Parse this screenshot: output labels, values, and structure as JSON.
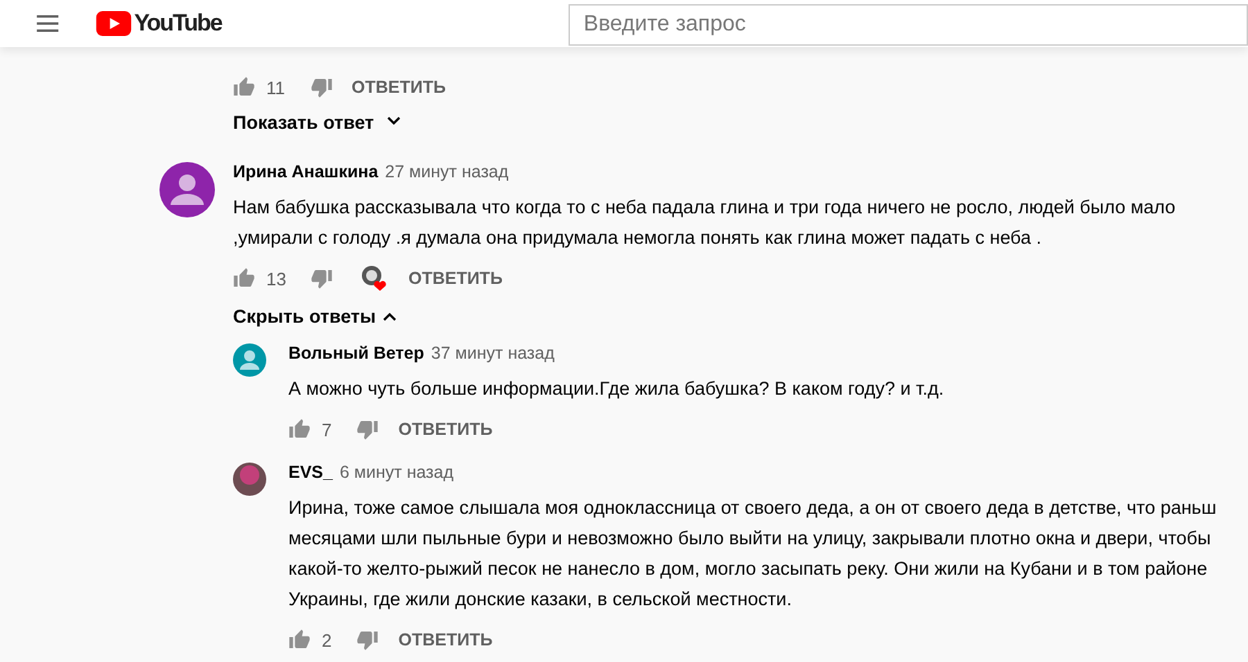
{
  "header": {
    "logo_text": "YouTube",
    "search": {
      "placeholder": "Введите запрос"
    }
  },
  "top_comment": {
    "likes": "11",
    "reply_label": "ОТВЕТИТЬ",
    "toggle_label": "Показать ответ",
    "expanded": false
  },
  "comment": {
    "author": "Ирина Анашкина",
    "time": "27 минут назад",
    "text": "Нам бабушка рассказывала что когда то с неба падала глина и три года ничего не росло, людей было мало\n,умирали с голоду .я думала она придумала немогла понять как глина может падать с неба .",
    "likes": "13",
    "hearted": true,
    "reply_label": "ОТВЕТИТЬ",
    "toggle_label": "Скрыть ответы",
    "expanded": true,
    "replies": [
      {
        "author": "Вольный Ветер",
        "time": "37 минут назад",
        "kind": "default_avatar",
        "text": "А можно чуть больше информации.Где жила бабушка? В каком году? и т.д.",
        "likes": "7",
        "reply_label": "ОТВЕТИТЬ"
      },
      {
        "author": "EVS_",
        "time": "6 минут назад",
        "kind": "photo_avatar",
        "text": "Ирина, тоже самое слышала моя одноклассница от своего деда, а он от своего деда в детстве, что раньш\nмесяцами шли пыльные бури и невозможно было выйти на улицу, закрывали плотно окна и двери, чтобы\nкакой-то желто-рыжий песок не нанесло в дом, могло засыпать реку. Они жили на Кубани и в том районе\nУкраины, где жили донские казаки, в сельской местности.",
        "likes": "2",
        "reply_label": "ОТВЕТИТЬ"
      }
    ]
  }
}
